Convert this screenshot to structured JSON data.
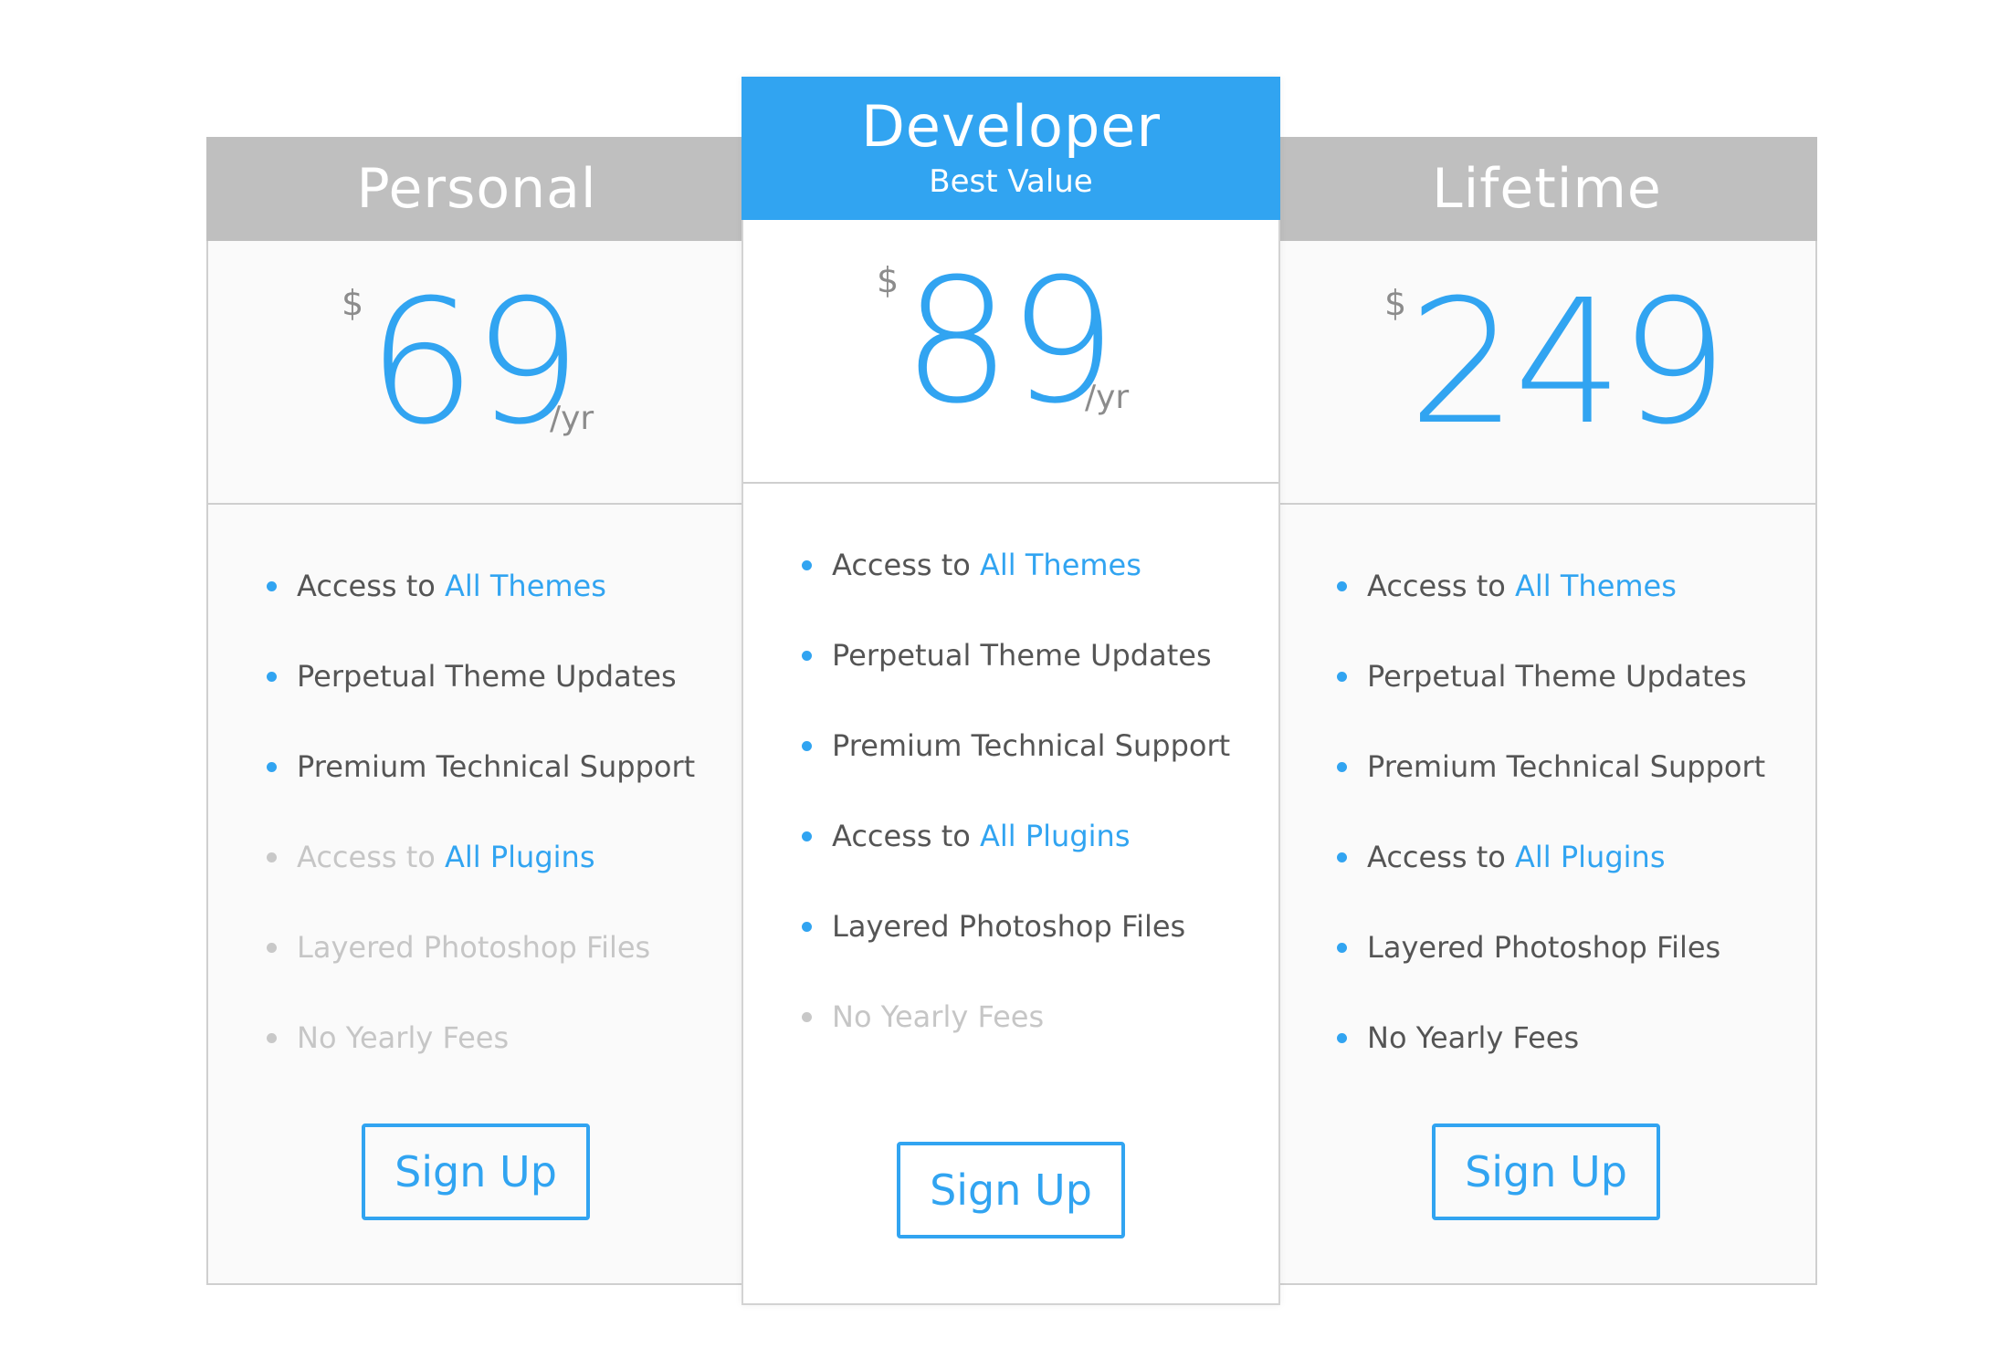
{
  "plans": {
    "personal": {
      "title": "Personal",
      "currency": "$",
      "amount": "69",
      "period": "/yr",
      "features": [
        {
          "prefix": "Access to ",
          "link": "All Themes",
          "included": true
        },
        {
          "prefix": "Perpetual Theme Updates",
          "link": "",
          "included": true
        },
        {
          "prefix": "Premium Technical Support",
          "link": "",
          "included": true
        },
        {
          "prefix": "Access to ",
          "link": "All Plugins",
          "included": false
        },
        {
          "prefix": "Layered Photoshop Files",
          "link": "",
          "included": false
        },
        {
          "prefix": "No Yearly Fees",
          "link": "",
          "included": false
        }
      ],
      "button": "Sign Up"
    },
    "developer": {
      "title": "Developer",
      "subtitle": "Best Value",
      "currency": "$",
      "amount": "89",
      "period": "/yr",
      "features": [
        {
          "prefix": "Access to ",
          "link": "All Themes",
          "included": true
        },
        {
          "prefix": "Perpetual Theme Updates",
          "link": "",
          "included": true
        },
        {
          "prefix": "Premium Technical Support",
          "link": "",
          "included": true
        },
        {
          "prefix": "Access to ",
          "link": "All Plugins",
          "included": true
        },
        {
          "prefix": "Layered Photoshop Files",
          "link": "",
          "included": true
        },
        {
          "prefix": "No Yearly Fees",
          "link": "",
          "included": false
        }
      ],
      "button": "Sign Up"
    },
    "lifetime": {
      "title": "Lifetime",
      "currency": "$",
      "amount": "249",
      "features": [
        {
          "prefix": "Access to ",
          "link": "All Themes",
          "included": true
        },
        {
          "prefix": "Perpetual Theme Updates",
          "link": "",
          "included": true
        },
        {
          "prefix": "Premium Technical Support",
          "link": "",
          "included": true
        },
        {
          "prefix": "Access to ",
          "link": "All Plugins",
          "included": true
        },
        {
          "prefix": "Layered Photoshop Files",
          "link": "",
          "included": true
        },
        {
          "prefix": "No Yearly Fees",
          "link": "",
          "included": true
        }
      ],
      "button": "Sign Up"
    }
  },
  "colors": {
    "accent": "#31a4f1",
    "header_gray": "#bfbfbf",
    "disabled_text": "#c6c6c6"
  }
}
